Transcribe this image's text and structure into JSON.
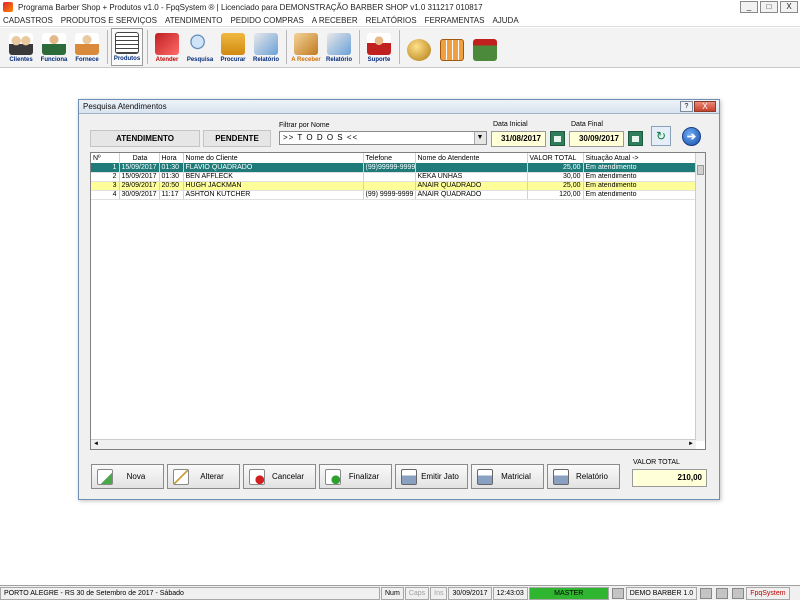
{
  "window": {
    "title": "Programa Barber Shop + Produtos v1.0 - FpqSystem ® | Licenciado para  DEMONSTRAÇÃO BARBER SHOP v1.0 311217 010817",
    "minimize": "_",
    "maximize": "□",
    "close": "X"
  },
  "menu": [
    "CADASTROS",
    "PRODUTOS E SERVIÇOS",
    "ATENDIMENTO",
    "PEDIDO COMPRAS",
    "A RECEBER",
    "RELATÓRIOS",
    "FERRAMENTAS",
    "AJUDA"
  ],
  "toolbar": {
    "clientes": "Clientes",
    "funciona": "Funciona",
    "fornece": "Fornece",
    "produtos": "Produtos",
    "atender": "Atender",
    "pesquisa": "Pesquisa",
    "procurar": "Procurar",
    "relatorio1": "Relatório",
    "areceber": "A Receber",
    "relatorio2": "Relatório",
    "suporte": "Suporte"
  },
  "dialog": {
    "title": "Pesquisa Atendimentos",
    "help": "?",
    "close": "X",
    "atendimento": "ATENDIMENTO",
    "pendente": "PENDENTE",
    "filter_label": "Filtrar por Nome",
    "filter_value": ">> T O D O S <<",
    "date_start_label": "Data Inicial",
    "date_start": "31/08/2017",
    "date_end_label": "Data Final",
    "date_end": "30/09/2017",
    "refresh_icon": "↻",
    "go_icon": "➔"
  },
  "grid": {
    "columns": [
      "Nº",
      "Data",
      "Hora",
      "Nome do Cliente",
      "Telefone",
      "Nome do Atendente",
      "VALOR TOTAL",
      "Situação Atual ->"
    ],
    "rows": [
      {
        "n": "1",
        "data": "15/09/2017",
        "hora": "01:30",
        "cliente": "FLAVIO QUADRADO",
        "telefone": "(99)99999-9999",
        "atendente": "",
        "valor": "25,00",
        "situacao": "Em atendimento"
      },
      {
        "n": "2",
        "data": "15/09/2017",
        "hora": "01:30",
        "cliente": "BEN AFFLECK",
        "telefone": "",
        "atendente": "KEKA UNHAS",
        "valor": "30,00",
        "situacao": "Em atendimento"
      },
      {
        "n": "3",
        "data": "29/09/2017",
        "hora": "20:50",
        "cliente": "HUGH JACKMAN",
        "telefone": "",
        "atendente": "ANAIR QUADRADO",
        "valor": "25,00",
        "situacao": "Em atendimento"
      },
      {
        "n": "4",
        "data": "30/09/2017",
        "hora": "11:17",
        "cliente": "ASHTON KUTCHER",
        "telefone": "(99) 9999-9999",
        "atendente": "ANAIR QUADRADO",
        "valor": "120,00",
        "situacao": "Em atendimento"
      }
    ],
    "scroll_left": "◄",
    "scroll_right": "►"
  },
  "actions": {
    "nova": "Nova",
    "alterar": "Alterar",
    "cancelar": "Cancelar",
    "finalizar": "Finalizar",
    "emitir_jato": "Emitir Jato",
    "matricial": "Matricial",
    "relatorio": "Relatório"
  },
  "total": {
    "label": "VALOR TOTAL",
    "value": "210,00"
  },
  "statusbar": {
    "location": "PORTO ALEGRE - RS 30 de Setembro de 2017 - Sábado",
    "num": "Num",
    "caps": "Caps",
    "ins": "Ins",
    "date": "30/09/2017",
    "time": "12:43:03",
    "master": "MASTER",
    "version": "DEMO BARBER 1.0",
    "brand": "FpqSystem"
  }
}
